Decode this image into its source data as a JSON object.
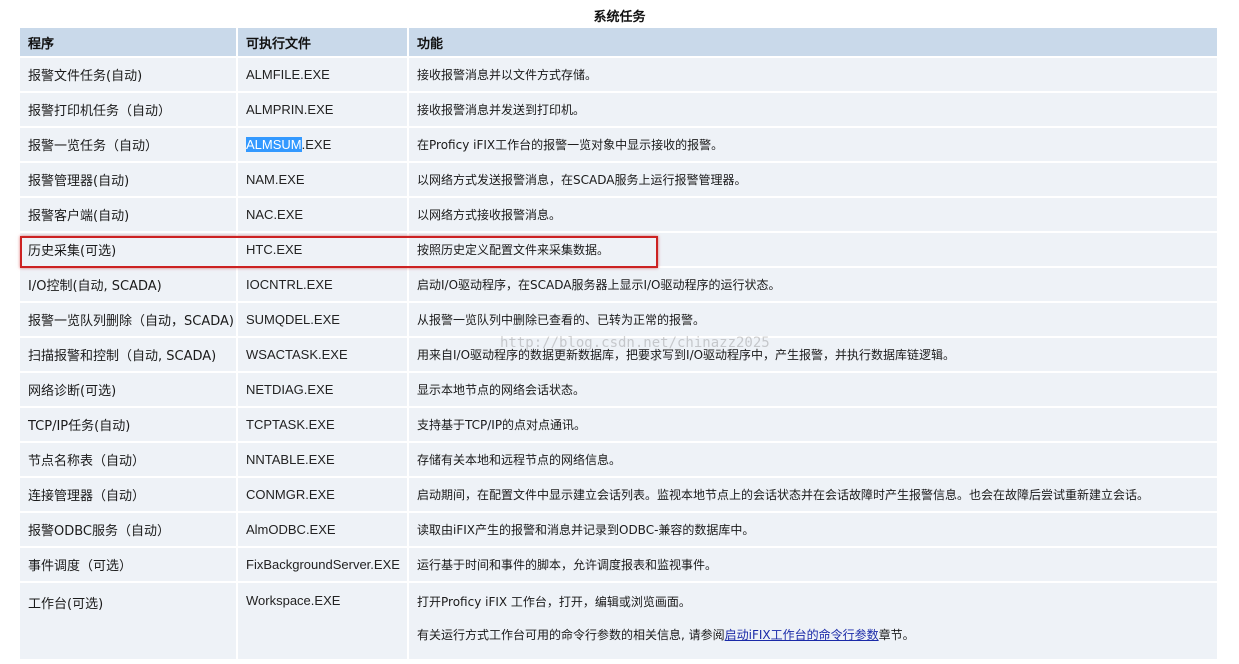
{
  "caption": "系统任务",
  "headers": {
    "program": "程序",
    "executable": "可执行文件",
    "function": "功能"
  },
  "rows": [
    {
      "program": "报警文件任务(自动)",
      "exe": "ALMFILE.EXE",
      "desc": "接收报警消息并以文件方式存储。"
    },
    {
      "program": "报警打印机任务（自动）",
      "exe": "ALMPRIN.EXE",
      "desc": "接收报警消息并发送到打印机。"
    },
    {
      "program": "报警一览任务（自动）",
      "exe_selected": "ALMSUM",
      "exe_rest": ".EXE",
      "desc": "在Proficy iFIX工作台的报警一览对象中显示接收的报警。"
    },
    {
      "program": "报警管理器(自动)",
      "exe": "NAM.EXE",
      "desc": "以网络方式发送报警消息，在SCADA服务上运行报警管理器。"
    },
    {
      "program": "报警客户端(自动)",
      "exe": "NAC.EXE",
      "desc": "以网络方式接收报警消息。"
    },
    {
      "program": "历史采集(可选)",
      "exe": "HTC.EXE",
      "desc": "按照历史定义配置文件来采集数据。"
    },
    {
      "program": "I/O控制(自动, SCADA)",
      "exe": "IOCNTRL.EXE",
      "desc": "启动I/O驱动程序，在SCADA服务器上显示I/O驱动程序的运行状态。"
    },
    {
      "program": "报警一览队列删除（自动，SCADA)",
      "exe": "SUMQDEL.EXE",
      "desc": "从报警一览队列中删除已查看的、已转为正常的报警。"
    },
    {
      "program": "扫描报警和控制（自动, SCADA)",
      "exe": "WSACTASK.EXE",
      "desc": "用来自I/O驱动程序的数据更新数据库，把要求写到I/O驱动程序中，产生报警，并执行数据库链逻辑。"
    },
    {
      "program": "网络诊断(可选)",
      "exe": "NETDIAG.EXE",
      "desc": "显示本地节点的网络会话状态。"
    },
    {
      "program": "TCP/IP任务(自动)",
      "exe": "TCPTASK.EXE",
      "desc": "支持基于TCP/IP的点对点通讯。"
    },
    {
      "program": "节点名称表（自动）",
      "exe": "NNTABLE.EXE",
      "desc": "存储有关本地和远程节点的网络信息。"
    },
    {
      "program": "连接管理器（自动）",
      "exe": "CONMGR.EXE",
      "desc": "启动期间，在配置文件中显示建立会话列表。监视本地节点上的会话状态并在会话故障时产生报警信息。也会在故障后尝试重新建立会话。"
    },
    {
      "program": "报警ODBC服务（自动）",
      "exe": "AlmODBC.EXE",
      "desc": "读取由iFIX产生的报警和消息并记录到ODBC-兼容的数据库中。"
    },
    {
      "program": "事件调度（可选）",
      "exe": "FixBackgroundServer.EXE",
      "desc": "运行基于时间和事件的脚本，允许调度报表和监视事件。"
    },
    {
      "program": "工作台(可选)",
      "exe": "Workspace.EXE",
      "desc": "打开Proficy iFIX 工作台，打开，编辑或浏览画面。",
      "desc2_prefix": "有关运行方式工作台可用的命令行参数的相关信息, 请参阅",
      "desc2_link": "启动iFIX工作台的命令行参数",
      "desc2_suffix": "章节。"
    }
  ],
  "watermark": "http://blog.csdn.net/chinazz2025",
  "highlight_color": "#cc2222",
  "selection_color": "#3399ff"
}
